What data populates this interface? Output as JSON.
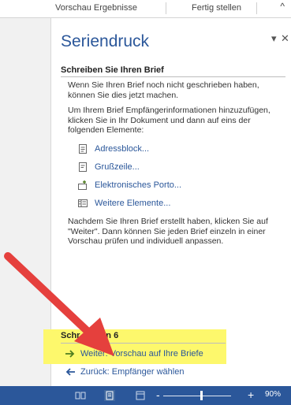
{
  "ribbon": {
    "tab_preview": "Vorschau Ergebnisse",
    "tab_finish": "Fertig stellen",
    "collapse_glyph": "^"
  },
  "pane": {
    "title": "Seriendruck",
    "options_glyph": "▾",
    "close_glyph": "✕",
    "section_heading": "Schreiben Sie Ihren Brief",
    "intro_text": "Wenn Sie Ihren Brief noch nicht geschrieben haben, können Sie dies jetzt machen.",
    "instructions_text": "Um Ihrem Brief Empfängerinformationen hinzuzufügen, klicken Sie in Ihr Dokument und dann auf eins der folgenden Elemente:",
    "links": [
      {
        "label": "Adressblock...",
        "icon": "address-block-icon"
      },
      {
        "label": "Grußzeile...",
        "icon": "greeting-line-icon"
      },
      {
        "label": "Elektronisches Porto...",
        "icon": "electronic-postage-icon"
      },
      {
        "label": "Weitere Elemente...",
        "icon": "more-items-icon"
      }
    ],
    "after_text": "Nachdem Sie Ihren Brief erstellt haben, klicken Sie auf \"Weiter\". Dann können Sie jeden Brief einzeln in einer Vorschau prüfen und individuell anpassen."
  },
  "steps": {
    "label_visible": "Schr",
    "label_end": "von 6",
    "next_label": "Weiter: Vorschau auf Ihre Briefe",
    "back_label": "Zurück: Empfänger wählen"
  },
  "statusbar": {
    "zoom_minus": "-",
    "zoom_plus": "+",
    "zoom_percent": "90%",
    "zoom_level": 0.9
  },
  "colors": {
    "accent": "#2b579a",
    "highlight": "#fdf86c",
    "arrow": "#e5403d",
    "nav_arrow": "#4f7d20"
  }
}
